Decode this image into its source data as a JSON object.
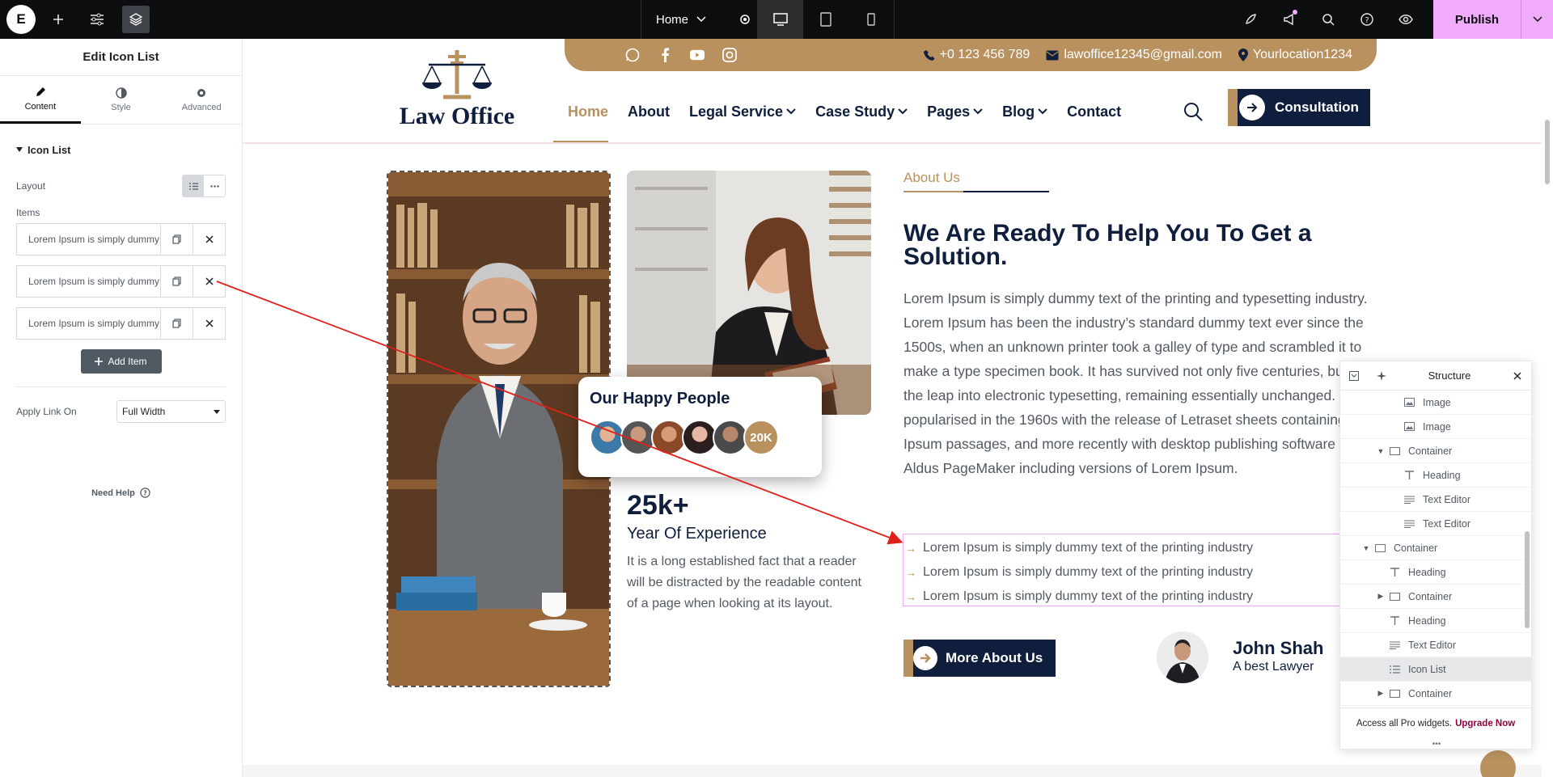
{
  "topbar": {
    "logo": "E",
    "page_name": "Home",
    "publish_label": "Publish",
    "icons": [
      "add-element-icon",
      "site-settings-icon",
      "structure-icon"
    ]
  },
  "panel": {
    "title": "Edit Icon List",
    "tabs": [
      {
        "label": "Content"
      },
      {
        "label": "Style"
      },
      {
        "label": "Advanced"
      }
    ],
    "section": "Icon List",
    "layout_label": "Layout",
    "items_label": "Items",
    "items": [
      {
        "title": "Lorem Ipsum is simply dummy text of the printing industry"
      },
      {
        "title": "Lorem Ipsum is simply dummy text of the printing industry"
      },
      {
        "title": "Lorem Ipsum is simply dummy text of the printing industry"
      }
    ],
    "add_item_label": "Add Item",
    "apply_link_label": "Apply Link On",
    "apply_link_value": "Full Width",
    "need_help": "Need Help"
  },
  "site": {
    "phone": "+0 123 456 789",
    "email": "lawoffice12345@gmail.com",
    "location": "Yourlocation1234",
    "logo_text": "Law Office",
    "nav": [
      {
        "label": "Home",
        "active": true,
        "dropdown": false
      },
      {
        "label": "About",
        "active": false,
        "dropdown": false
      },
      {
        "label": "Legal Service",
        "active": false,
        "dropdown": true
      },
      {
        "label": "Case Study",
        "active": false,
        "dropdown": true
      },
      {
        "label": "Pages",
        "active": false,
        "dropdown": true
      },
      {
        "label": "Blog",
        "active": false,
        "dropdown": true
      },
      {
        "label": "Contact",
        "active": false,
        "dropdown": false
      }
    ],
    "consultation_label": "Consultation",
    "happy_title": "Our Happy People",
    "happy_count": "20K",
    "stat_number": "25k+",
    "stat_label": "Year Of Experience",
    "stat_desc": "It is a long established fact that a reader will be distracted by the readable content of a page when looking at its layout.",
    "about_tag": "About Us",
    "about_heading": "We Are Ready To Help You To Get a Solution.",
    "about_text": "Lorem Ipsum is simply dummy text of the printing and typesetting industry. Lorem Ipsum has been the industry’s standard dummy text ever since the 1500s, when an unknown printer took a galley of type and scrambled it to make a type specimen book. It has survived not only five centuries, but also the leap into electronic typesetting, remaining essentially unchanged. It was popularised in the 1960s with the release of Letraset sheets containing Lorem Ipsum passages, and more recently with desktop publishing software like Aldus PageMaker including versions of Lorem Ipsum.",
    "icon_list": [
      "Lorem Ipsum is simply dummy text of the printing industry",
      "Lorem Ipsum is simply dummy text of the printing industry",
      "Lorem Ipsum is simply dummy text of the printing industry"
    ],
    "more_label": "More About Us",
    "lawyer_name": "John Shah",
    "lawyer_role": "A best Lawyer"
  },
  "structure": {
    "title": "Structure",
    "rows": [
      {
        "label": "Image",
        "icon": "image",
        "indent": 4,
        "caret": ""
      },
      {
        "label": "Image",
        "icon": "image",
        "indent": 4,
        "caret": ""
      },
      {
        "label": "Container",
        "icon": "container",
        "indent": 3,
        "caret": "down"
      },
      {
        "label": "Heading",
        "icon": "heading",
        "indent": 4,
        "caret": ""
      },
      {
        "label": "Text Editor",
        "icon": "text",
        "indent": 4,
        "caret": ""
      },
      {
        "label": "Text Editor",
        "icon": "text",
        "indent": 4,
        "caret": ""
      },
      {
        "label": "Container",
        "icon": "container",
        "indent": 2,
        "caret": "down"
      },
      {
        "label": "Heading",
        "icon": "heading",
        "indent": 3,
        "caret": ""
      },
      {
        "label": "Container",
        "icon": "container",
        "indent": 3,
        "caret": "right"
      },
      {
        "label": "Heading",
        "icon": "heading",
        "indent": 3,
        "caret": ""
      },
      {
        "label": "Text Editor",
        "icon": "text",
        "indent": 3,
        "caret": ""
      },
      {
        "label": "Icon List",
        "icon": "list",
        "indent": 3,
        "caret": "",
        "selected": true
      },
      {
        "label": "Container",
        "icon": "container",
        "indent": 3,
        "caret": "right"
      }
    ],
    "footer_text": "Access all Pro widgets.",
    "footer_link": "Upgrade Now"
  }
}
